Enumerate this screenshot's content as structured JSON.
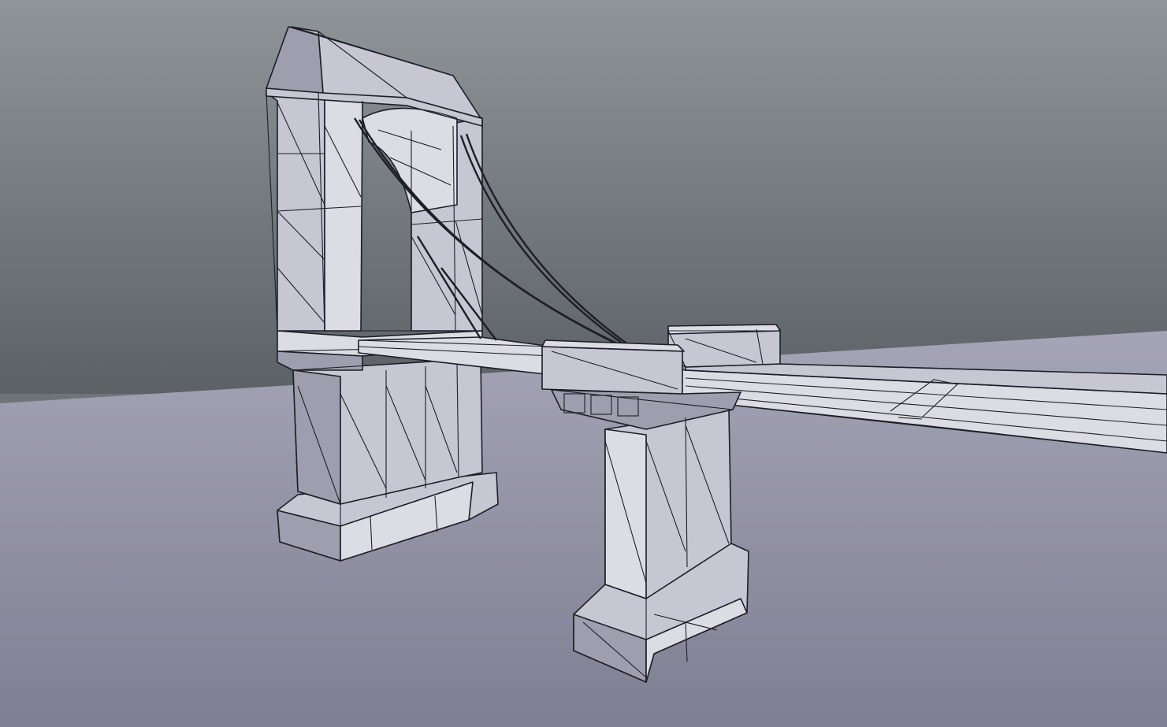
{
  "viewport": {
    "colors": {
      "sky_top": "#8f9598",
      "sky_bottom": "#5c6166",
      "ground_near": "#7e7f92",
      "ground_far": "#a4a5b6",
      "mesh_face": "#c7c7d3",
      "mesh_face_dark": "#9e9eae",
      "mesh_face_light": "#dcdce4",
      "wire": "#1e1e26"
    },
    "objects": [
      {
        "name": "arch-tower",
        "icon": "wireframe-mesh"
      },
      {
        "name": "front-pier",
        "icon": "wireframe-mesh"
      },
      {
        "name": "rear-pier-cap",
        "icon": "wireframe-mesh"
      },
      {
        "name": "bridge-deck",
        "icon": "wireframe-mesh"
      },
      {
        "name": "suspension-cables",
        "icon": "wireframe-mesh"
      }
    ]
  }
}
